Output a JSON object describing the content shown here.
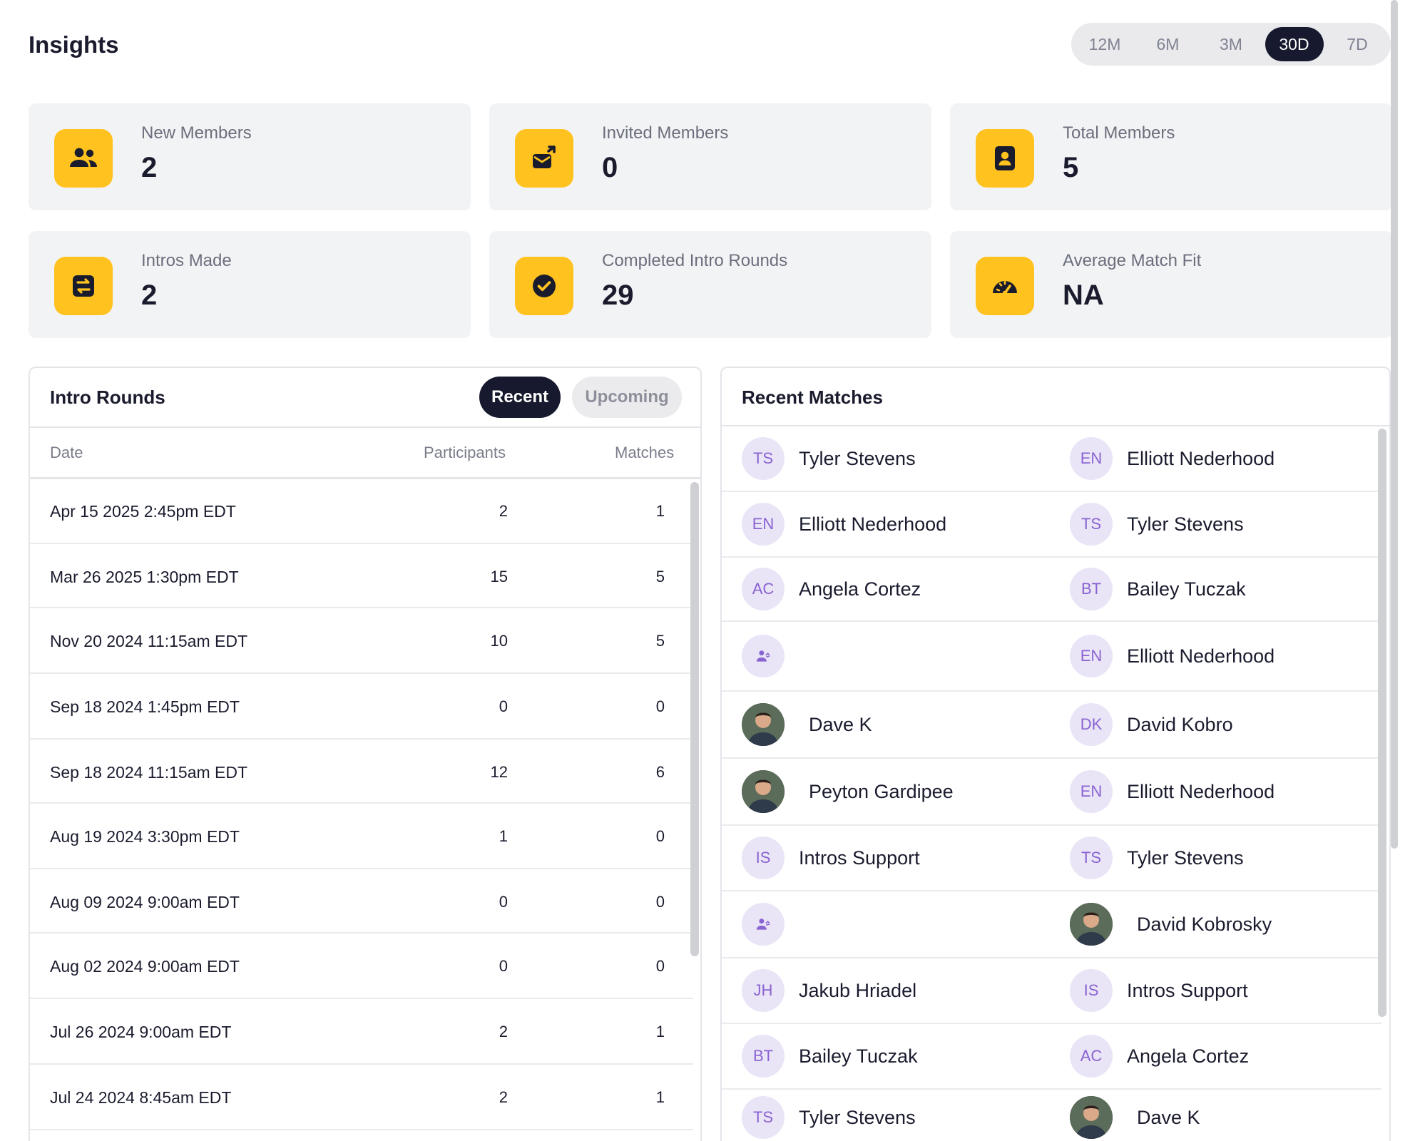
{
  "header": {
    "title": "Insights",
    "ranges": [
      "12M",
      "6M",
      "3M",
      "30D",
      "7D"
    ],
    "active_range": "30D"
  },
  "stats": [
    {
      "label": "New Members",
      "value": "2",
      "icon": "people-icon"
    },
    {
      "label": "Invited Members",
      "value": "0",
      "icon": "invite-icon"
    },
    {
      "label": "Total Members",
      "value": "5",
      "icon": "member-badge-icon"
    },
    {
      "label": "Intros Made",
      "value": "2",
      "icon": "swap-icon"
    },
    {
      "label": "Completed Intro Rounds",
      "value": "29",
      "icon": "check-circle-icon"
    },
    {
      "label": "Average Match Fit",
      "value": "NA",
      "icon": "gauge-icon"
    }
  ],
  "intro_rounds": {
    "title": "Intro Rounds",
    "tabs": {
      "recent": "Recent",
      "upcoming": "Upcoming"
    },
    "columns": {
      "date": "Date",
      "participants": "Participants",
      "matches": "Matches"
    },
    "rows": [
      {
        "date": "Apr 15 2025 2:45pm EDT",
        "participants": "2",
        "matches": "1"
      },
      {
        "date": "Mar 26 2025 1:30pm EDT",
        "participants": "15",
        "matches": "5"
      },
      {
        "date": "Nov 20 2024 11:15am EDT",
        "participants": "10",
        "matches": "5"
      },
      {
        "date": "Sep 18 2024 1:45pm EDT",
        "participants": "0",
        "matches": "0"
      },
      {
        "date": "Sep 18 2024 11:15am EDT",
        "participants": "12",
        "matches": "6"
      },
      {
        "date": "Aug 19 2024 3:30pm EDT",
        "participants": "1",
        "matches": "0"
      },
      {
        "date": "Aug 09 2024 9:00am EDT",
        "participants": "0",
        "matches": "0"
      },
      {
        "date": "Aug 02 2024 9:00am EDT",
        "participants": "0",
        "matches": "0"
      },
      {
        "date": "Jul 26 2024 9:00am EDT",
        "participants": "2",
        "matches": "1"
      },
      {
        "date": "Jul 24 2024 8:45am EDT",
        "participants": "2",
        "matches": "1"
      }
    ]
  },
  "recent_matches": {
    "title": "Recent Matches",
    "rows": [
      {
        "a": {
          "initials": "TS",
          "name": "Tyler Stevens"
        },
        "b": {
          "initials": "EN",
          "name": "Elliott Nederhood"
        }
      },
      {
        "a": {
          "initials": "EN",
          "name": "Elliott Nederhood"
        },
        "b": {
          "initials": "TS",
          "name": "Tyler Stevens"
        }
      },
      {
        "a": {
          "initials": "AC",
          "name": "Angela Cortez"
        },
        "b": {
          "initials": "BT",
          "name": "Bailey Tuczak"
        }
      },
      {
        "a": {
          "initials": "",
          "name": "",
          "icon": "group-icon"
        },
        "b": {
          "initials": "EN",
          "name": "Elliott Nederhood"
        }
      },
      {
        "a": {
          "initials": "",
          "name": "Dave K",
          "photo": true
        },
        "b": {
          "initials": "DK",
          "name": "David Kobro"
        }
      },
      {
        "a": {
          "initials": "",
          "name": "Peyton Gardipee",
          "photo": true
        },
        "b": {
          "initials": "EN",
          "name": "Elliott Nederhood"
        }
      },
      {
        "a": {
          "initials": "IS",
          "name": "Intros Support"
        },
        "b": {
          "initials": "TS",
          "name": "Tyler Stevens"
        }
      },
      {
        "a": {
          "initials": "",
          "name": "",
          "icon": "group-icon"
        },
        "b": {
          "initials": "",
          "name": "David Kobrosky",
          "photo": true
        }
      },
      {
        "a": {
          "initials": "JH",
          "name": "Jakub Hriadel"
        },
        "b": {
          "initials": "IS",
          "name": "Intros Support"
        }
      },
      {
        "a": {
          "initials": "BT",
          "name": "Bailey Tuczak"
        },
        "b": {
          "initials": "AC",
          "name": "Angela Cortez"
        }
      },
      {
        "a": {
          "initials": "TS",
          "name": "Tyler Stevens"
        },
        "b": {
          "initials": "",
          "name": "Dave K",
          "photo": true
        }
      }
    ]
  },
  "colors": {
    "accent_yellow": "#ffc21f",
    "dark": "#171a2e",
    "avatar_bg": "#e9e4f6",
    "avatar_text": "#8a63d2"
  }
}
